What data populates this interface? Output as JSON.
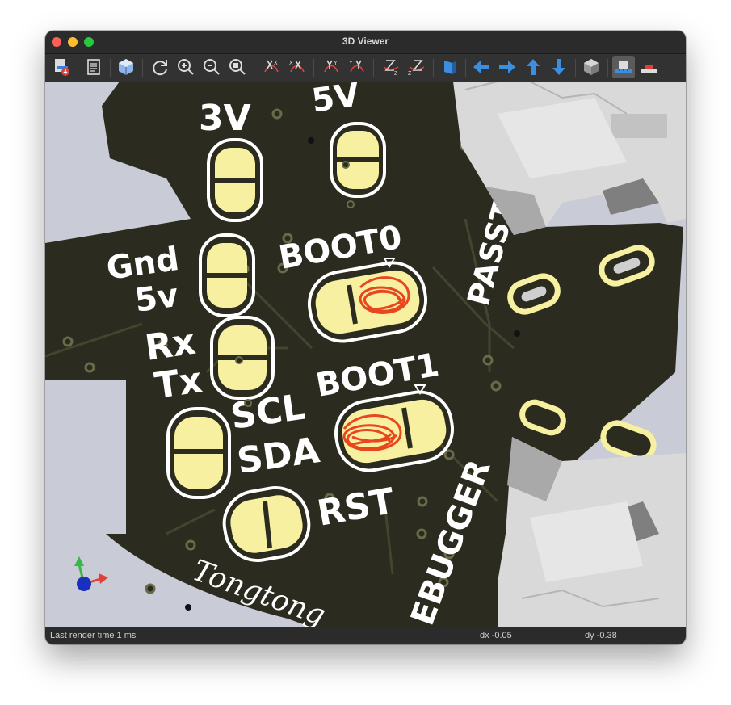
{
  "window": {
    "title": "3D Viewer"
  },
  "toolbar": {
    "buttons": [
      "export-image-icon",
      "copy-to-clipboard-icon",
      "raytracing-icon",
      "reload-icon",
      "zoom-in-icon",
      "zoom-out-icon",
      "zoom-fit-icon",
      "rotate-x-cw-icon",
      "rotate-x-ccw-icon",
      "rotate-y-cw-icon",
      "rotate-y-ccw-icon",
      "rotate-z-cw-icon",
      "rotate-z-ccw-icon",
      "flip-board-icon",
      "pan-left-icon",
      "pan-right-icon",
      "pan-up-icon",
      "pan-down-icon",
      "perspective-icon",
      "render-mode-icon",
      "board-body-icon"
    ]
  },
  "board": {
    "labels": {
      "v3": "3V",
      "v5_top": "5V",
      "passthrough": "PASSTHROU",
      "gnd": "Gnd",
      "v5_small": "5v",
      "rx": "Rx",
      "tx": "Tx",
      "boot0": "BOOT0",
      "boot1": "BOOT1",
      "scl": "SCL",
      "sda": "SDA",
      "rst": "RST",
      "debugger": "EBUGGER",
      "signature": "Tongtong"
    },
    "colors": {
      "soldermask": "#2b2c1f",
      "silkscreen": "#ffffff",
      "pad": "#f6f0a0",
      "annotation": "#e8461f",
      "connector": "#d9d9d9"
    }
  },
  "status": {
    "render_time": "Last render time 1 ms",
    "dx": "dx -0.05",
    "dy": "dy -0.38"
  }
}
